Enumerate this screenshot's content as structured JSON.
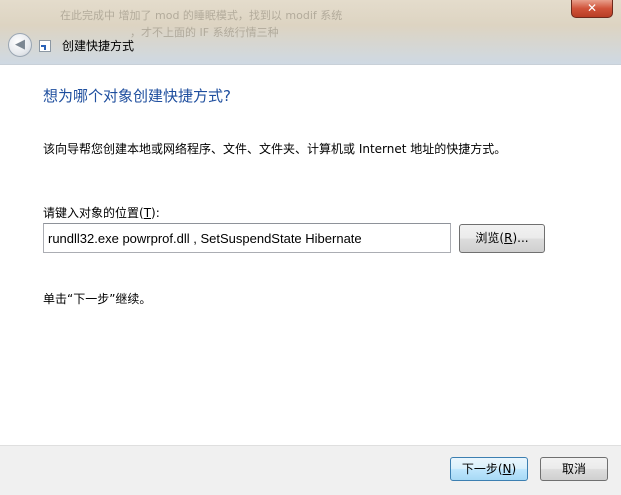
{
  "window": {
    "title": "创建快捷方式",
    "close_label": "✕",
    "back_label": "◀"
  },
  "background_text": {
    "line1": "在此完成中   增加了 mod 的睡眠模式，找到以 modif 系统",
    "line2": "，才不上面的 IF 系统行情三种"
  },
  "wizard": {
    "heading": "想为哪个对象创建快捷方式?",
    "description": "该向导帮您创建本地或网络程序、文件、文件夹、计算机或 Internet 地址的快捷方式。",
    "location_label": "请键入对象的位置(",
    "location_hotkey": "T",
    "location_label_end": "):",
    "location_value": "rundll32.exe powrprof.dll , SetSuspendState Hibernate",
    "browse_label": "浏览(",
    "browse_hotkey": "R",
    "browse_label_end": ")...",
    "hint": "单击“下一步”继续。"
  },
  "footer": {
    "next_label": "下一步(",
    "next_hotkey": "N",
    "next_label_end": ")",
    "cancel_label": "取消"
  }
}
